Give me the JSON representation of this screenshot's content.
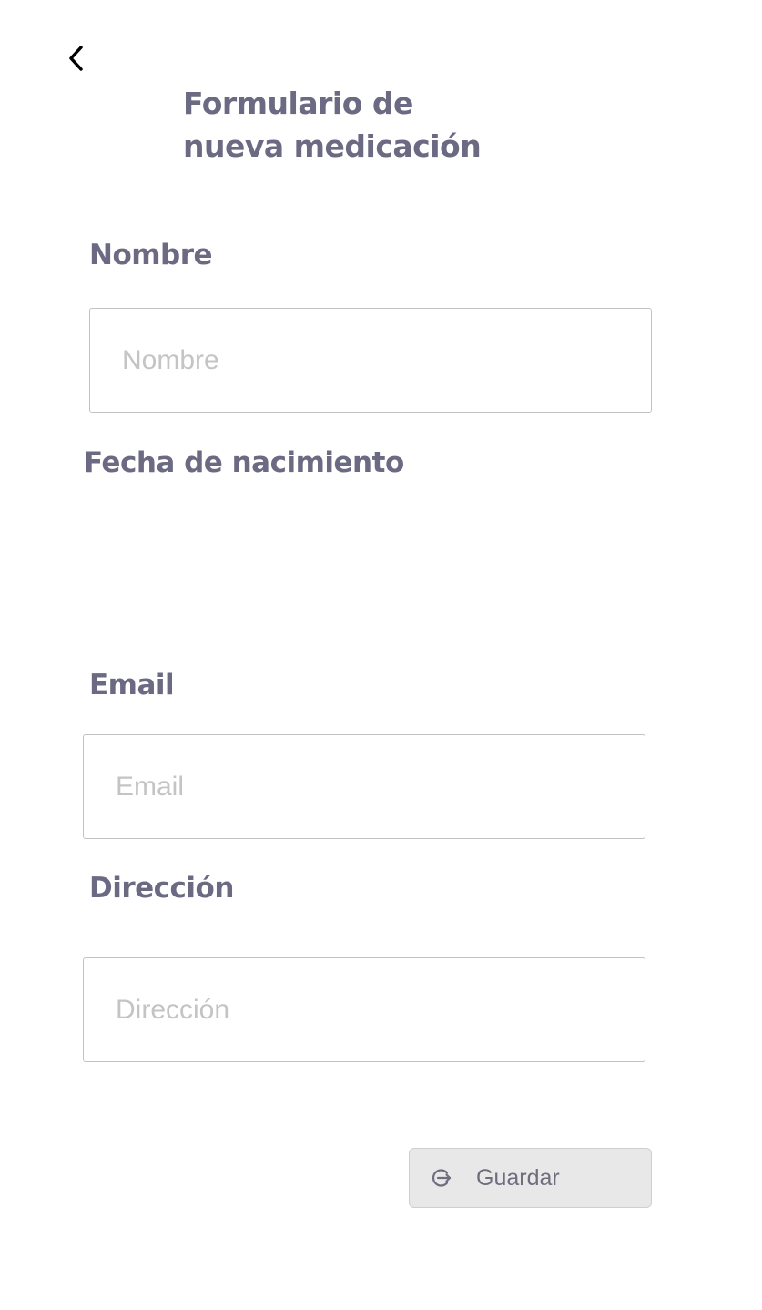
{
  "header": {
    "back_icon": "chevron-left-icon",
    "title_line1": "Formulario de",
    "title_line2": "nueva medicación"
  },
  "form": {
    "nombre": {
      "label": "Nombre",
      "placeholder": "Nombre",
      "value": ""
    },
    "fecha_nacimiento": {
      "label": "Fecha de nacimiento"
    },
    "email": {
      "label": "Email",
      "placeholder": "Email",
      "value": ""
    },
    "direccion": {
      "label": "Dirección",
      "placeholder": "Dirección",
      "value": ""
    }
  },
  "actions": {
    "save_label": "Guardar",
    "save_icon": "login-arrow-icon"
  },
  "colors": {
    "heading": "#6b6a82",
    "placeholder": "#c4c4c4",
    "input_border": "#c2c2c2",
    "button_bg": "#e8e8e8",
    "button_text": "#6e6e7e"
  }
}
